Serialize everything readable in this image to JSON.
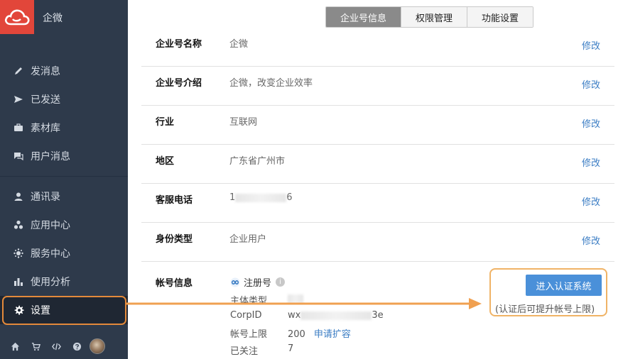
{
  "app": {
    "name": "企微"
  },
  "sidebar": {
    "items": [
      {
        "label": "发消息",
        "icon": "pencil-icon"
      },
      {
        "label": "已发送",
        "icon": "send-icon"
      },
      {
        "label": "素材库",
        "icon": "briefcase-icon"
      },
      {
        "label": "用户消息",
        "icon": "chat-icon"
      },
      {
        "label": "通讯录",
        "icon": "user-icon"
      },
      {
        "label": "应用中心",
        "icon": "apps-icon"
      },
      {
        "label": "服务中心",
        "icon": "service-icon"
      },
      {
        "label": "使用分析",
        "icon": "bar-chart-icon"
      },
      {
        "label": "设置",
        "icon": "gear-icon",
        "active": true
      }
    ],
    "bottom_icons": [
      "home-icon",
      "cart-icon",
      "code-icon",
      "help-icon",
      "avatar"
    ]
  },
  "tabs": [
    {
      "label": "企业号信息",
      "active": true
    },
    {
      "label": "权限管理"
    },
    {
      "label": "功能设置"
    }
  ],
  "info_rows": [
    {
      "label": "企业号名称",
      "value": "企微",
      "edit": "修改"
    },
    {
      "label": "企业号介绍",
      "value": "企微，改变企业效率",
      "edit": "修改"
    },
    {
      "label": "行业",
      "value": "互联网",
      "edit": "修改"
    },
    {
      "label": "地区",
      "value": "广东省广州市",
      "edit": "修改"
    },
    {
      "label": "客服电话",
      "value_prefix": "1",
      "value_suffix": "6",
      "edit": "修改"
    },
    {
      "label": "身份类型",
      "value": "企业用户",
      "edit": "修改"
    }
  ],
  "account": {
    "label": "帐号信息",
    "status": "注册号",
    "fields": [
      {
        "key": "主体类型",
        "value": ""
      },
      {
        "key": "CorpID",
        "value_prefix": "wx",
        "value_suffix": "3e"
      },
      {
        "key": "帐号上限",
        "value": "200",
        "link": "申请扩容"
      },
      {
        "key": "已关注",
        "value": "7"
      }
    ]
  },
  "certify": {
    "button": "进入认证系统",
    "hint": "(认证后可提升帐号上限)"
  },
  "colors": {
    "sidebar_bg": "#2e3a4b",
    "logo_bg": "#e2463a",
    "highlight_orange": "#e3893a",
    "link_blue": "#3b7dc4",
    "button_blue": "#4a90d9"
  }
}
